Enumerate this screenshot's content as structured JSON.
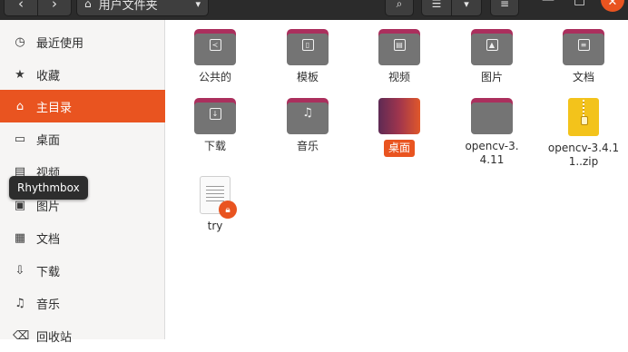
{
  "header": {
    "back_icon": "chevron-left",
    "forward_icon": "chevron-right",
    "path_label": "用户文件夹",
    "path_icon": "home-icon",
    "search_icon": "search-icon",
    "view_icon": "list-view-icon",
    "menu_icon": "hamburger-icon",
    "window": {
      "minimize": "—",
      "maximize": "□",
      "close": "✕"
    }
  },
  "sidebar": {
    "items": [
      {
        "label": "最近使用",
        "icon": "clock-icon",
        "glyph": "◷",
        "active": false
      },
      {
        "label": "收藏",
        "icon": "star-icon",
        "glyph": "★",
        "active": false
      },
      {
        "label": "主目录",
        "icon": "home-icon",
        "glyph": "⌂",
        "active": true
      },
      {
        "label": "桌面",
        "icon": "desktop-icon",
        "glyph": "▭",
        "active": false
      },
      {
        "label": "视频",
        "icon": "video-icon",
        "glyph": "▤",
        "active": false
      },
      {
        "label": "图片",
        "icon": "image-icon",
        "glyph": "▣",
        "active": false
      },
      {
        "label": "文档",
        "icon": "document-icon",
        "glyph": "▦",
        "active": false
      },
      {
        "label": "下载",
        "icon": "download-icon",
        "glyph": "⇩",
        "active": false
      },
      {
        "label": "音乐",
        "icon": "music-icon",
        "glyph": "♫",
        "active": false
      },
      {
        "label": "回收站",
        "icon": "trash-icon",
        "glyph": "⌫",
        "active": false
      }
    ]
  },
  "tooltip": {
    "text": "Rhythmbox"
  },
  "files": [
    {
      "name": "公共的",
      "type": "folder",
      "icon": "share-icon"
    },
    {
      "name": "模板",
      "type": "folder",
      "icon": "template-icon"
    },
    {
      "name": "视频",
      "type": "folder",
      "icon": "video-icon"
    },
    {
      "name": "图片",
      "type": "folder",
      "icon": "image-icon"
    },
    {
      "name": "文档",
      "type": "folder",
      "icon": "document-icon"
    },
    {
      "name": "下载",
      "type": "folder",
      "icon": "download-icon"
    },
    {
      "name": "音乐",
      "type": "folder",
      "icon": "music-icon"
    },
    {
      "name": "桌面",
      "type": "desktop-folder",
      "selected": true
    },
    {
      "name": "opencv-3.4.11",
      "type": "folder",
      "icon": "folder-icon"
    },
    {
      "name": "opencv-3.4.11..zip",
      "type": "zip",
      "icon": "zip-icon"
    },
    {
      "name": "try",
      "type": "text-file-locked",
      "icon": "locked-text-file-icon"
    }
  ],
  "colors": {
    "accent": "#e95420",
    "folder_tab": "#ab2f5d",
    "folder_body": "#747474",
    "header": "#2b2b2b"
  }
}
